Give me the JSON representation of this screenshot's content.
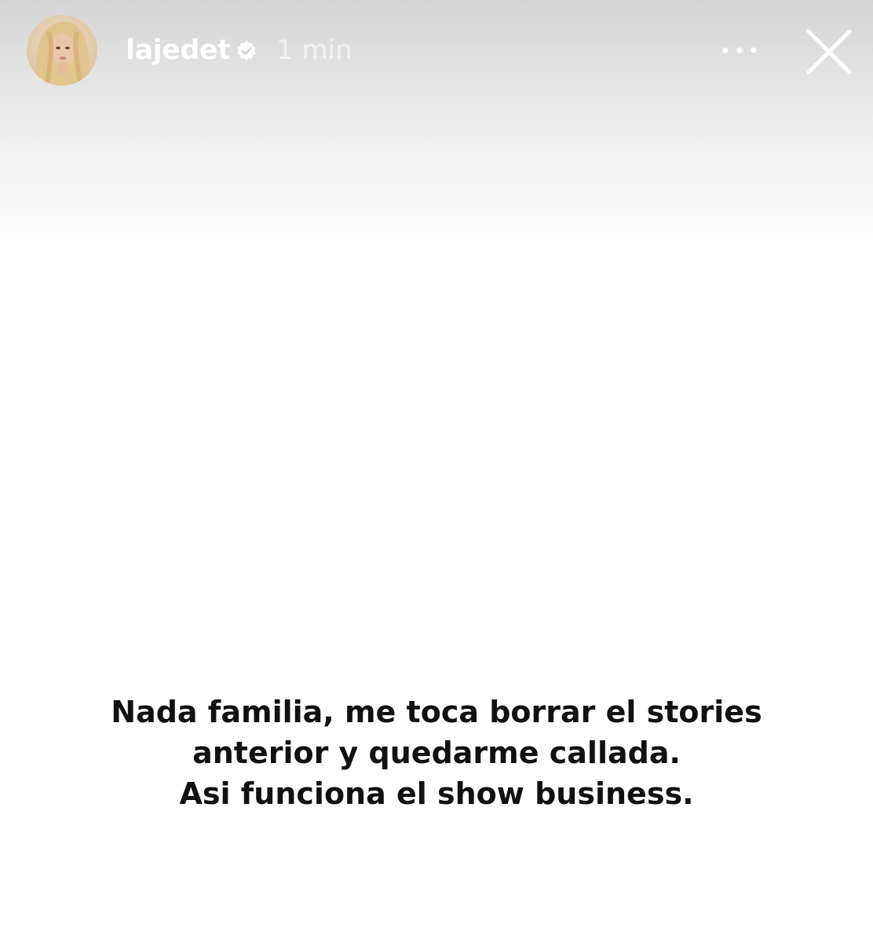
{
  "story": {
    "username": "lajedet",
    "timestamp": "1 min",
    "caption_lines": [
      "Nada familia, me toca borrar el stories",
      "anterior y quedarme callada.",
      "Asi funciona el show business."
    ]
  },
  "icons": {
    "verified": "verified-badge-icon",
    "more": "more-options-icon",
    "close": "close-icon"
  },
  "colors": {
    "header_gradient_top": "#d4d4d4",
    "background": "#ffffff",
    "caption_text": "#111111",
    "header_text": "#ffffff"
  }
}
